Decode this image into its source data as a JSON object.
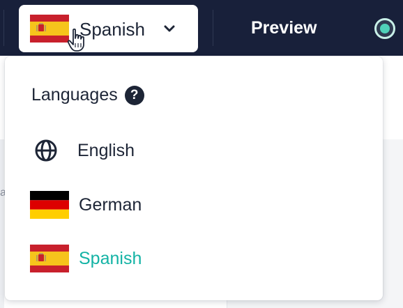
{
  "header": {
    "selected_language": "Spanish",
    "preview_label": "Preview",
    "accent_color": "#18203a"
  },
  "dropdown": {
    "title": "Languages",
    "help_symbol": "?",
    "options": [
      {
        "label": "English",
        "icon": "globe-icon",
        "selected": false
      },
      {
        "label": "German",
        "icon": "german-flag-icon",
        "selected": false
      },
      {
        "label": "Spanish",
        "icon": "spanish-flag-icon",
        "selected": true
      }
    ],
    "selected_color": "#14b3a5"
  },
  "background": {
    "edge_letter": "a"
  }
}
